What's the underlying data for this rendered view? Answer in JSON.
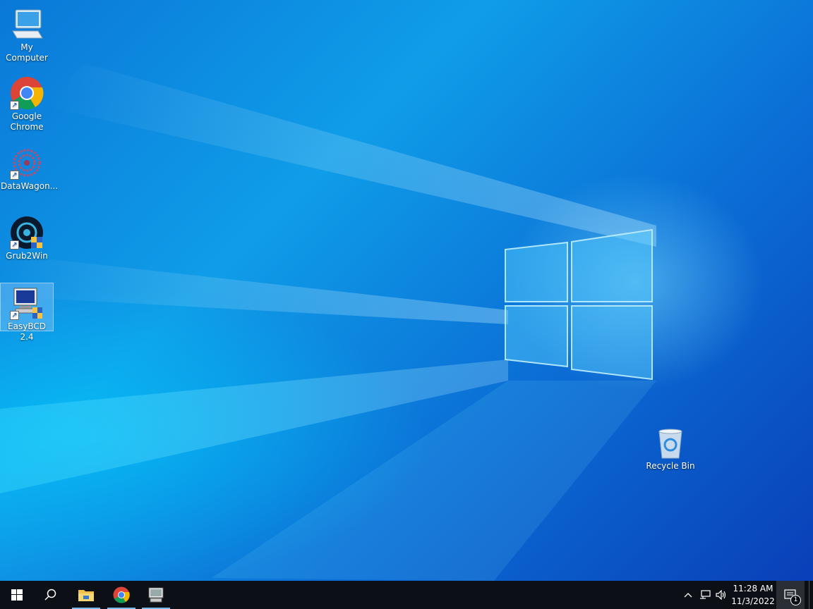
{
  "desktop": {
    "icons": [
      {
        "label_line1": "My",
        "label_line2": "Computer",
        "icon": "computer-icon"
      },
      {
        "label_line1": "Google",
        "label_line2": "Chrome",
        "icon": "chrome-icon"
      },
      {
        "label": "DataWagon...",
        "icon": "datawagon-icon"
      },
      {
        "label": "Grub2Win",
        "icon": "grub2win-icon"
      },
      {
        "label": "EasyBCD 2.4",
        "icon": "easybcd-icon",
        "selected": true
      },
      {
        "label": "Recycle Bin",
        "icon": "recycle-bin-icon"
      }
    ]
  },
  "taskbar": {
    "buttons": [
      {
        "name": "start",
        "icon": "windows-logo-icon"
      },
      {
        "name": "search",
        "icon": "search-icon"
      },
      {
        "name": "file-explorer",
        "icon": "folder-icon",
        "open": true
      },
      {
        "name": "chrome",
        "icon": "chrome-icon",
        "open": true
      },
      {
        "name": "easybcd",
        "icon": "easybcd-icon",
        "open": true
      }
    ],
    "tray": {
      "icons": [
        "chevron-up-icon",
        "network-icon",
        "volume-icon"
      ],
      "time": "11:28 AM",
      "date": "11/3/2022",
      "notification_count": "1"
    }
  },
  "colors": {
    "taskbar": "#0c1016",
    "accent": "#76b9ed",
    "wallpaper": "#0f9de8"
  }
}
